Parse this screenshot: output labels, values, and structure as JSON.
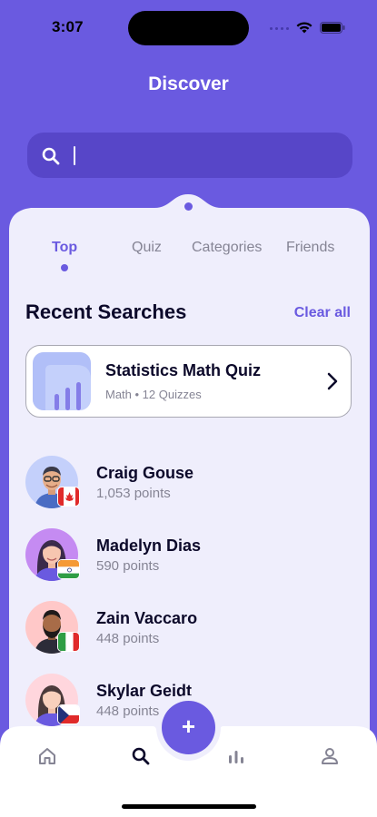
{
  "status_bar": {
    "time": "3:07"
  },
  "header": {
    "title": "Discover"
  },
  "search": {
    "value": "",
    "placeholder": ""
  },
  "tabs": [
    {
      "label": "Top",
      "active": true
    },
    {
      "label": "Quiz",
      "active": false
    },
    {
      "label": "Categories",
      "active": false
    },
    {
      "label": "Friends",
      "active": false
    }
  ],
  "recent": {
    "heading": "Recent Searches",
    "clear_label": "Clear all",
    "quiz": {
      "title": "Statistics Math Quiz",
      "subtitle": "Math • 12 Quizzes",
      "icon": "bar-chart-icon"
    }
  },
  "friends": [
    {
      "name": "Craig Gouse",
      "points": "1,053 points",
      "flag": "canada"
    },
    {
      "name": "Madelyn Dias",
      "points": "590 points",
      "flag": "india"
    },
    {
      "name": "Zain Vaccaro",
      "points": "448 points",
      "flag": "italy"
    },
    {
      "name": "Skylar Geidt",
      "points": "448 points",
      "flag": "czech"
    }
  ],
  "bottom_nav": {
    "items": [
      "home-icon",
      "search-icon",
      "plus-icon",
      "stats-icon",
      "profile-icon"
    ],
    "active": "search-icon"
  },
  "colors": {
    "primary": "#6A5AE0",
    "panel": "#EFEEFC",
    "text": "#0C092A",
    "muted": "#858494"
  }
}
